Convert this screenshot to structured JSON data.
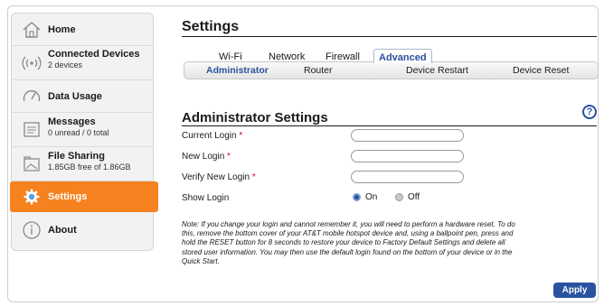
{
  "sidebar": {
    "items": [
      {
        "title": "Home",
        "subtitle": "",
        "icon": "home-icon"
      },
      {
        "title": "Connected Devices",
        "subtitle": "2 devices",
        "icon": "wifi-signal-icon"
      },
      {
        "title": "Data Usage",
        "subtitle": "",
        "icon": "gauge-icon"
      },
      {
        "title": "Messages",
        "subtitle": "0 unread / 0 total",
        "icon": "message-icon"
      },
      {
        "title": "File Sharing",
        "subtitle": "1.85GB free of 1.86GB",
        "icon": "folder-icon"
      },
      {
        "title": "Settings",
        "subtitle": "",
        "icon": "gear-icon",
        "active": true
      },
      {
        "title": "About",
        "subtitle": "",
        "icon": "info-icon"
      }
    ]
  },
  "main": {
    "title": "Settings",
    "tabs": [
      "Wi-Fi",
      "Network",
      "Firewall",
      "Advanced"
    ],
    "active_tab": "Advanced",
    "subtabs": [
      "Administrator",
      "Router",
      "Device Restart",
      "Device Reset"
    ],
    "active_subtab": "Administrator",
    "section_title": "Administrator Settings",
    "help_symbol": "?",
    "fields": {
      "current_login": {
        "label": "Current Login",
        "required": "*",
        "value": ""
      },
      "new_login": {
        "label": "New Login",
        "required": "*",
        "value": ""
      },
      "verify_login": {
        "label": "Verify New Login",
        "required": "*",
        "value": ""
      }
    },
    "show_login": {
      "label": "Show Login",
      "on_label": "On",
      "off_label": "Off",
      "selected": "On"
    },
    "note": "Note: If you change your login and cannot remember it, you will need to perform a hardware reset. To do this, remove the bottom cover of your AT&T mobile hotspot device and, using a ballpoint pen, press and hold the RESET button for 8 seconds to restore your device to Factory Default Settings and delete all stored user information. You may then use the default login found on the bottom of your device or in the Quick Start.",
    "apply_label": "Apply"
  },
  "colors": {
    "accent_orange": "#f5821f",
    "link_blue": "#2a52a0",
    "required_red": "#d0021b"
  }
}
